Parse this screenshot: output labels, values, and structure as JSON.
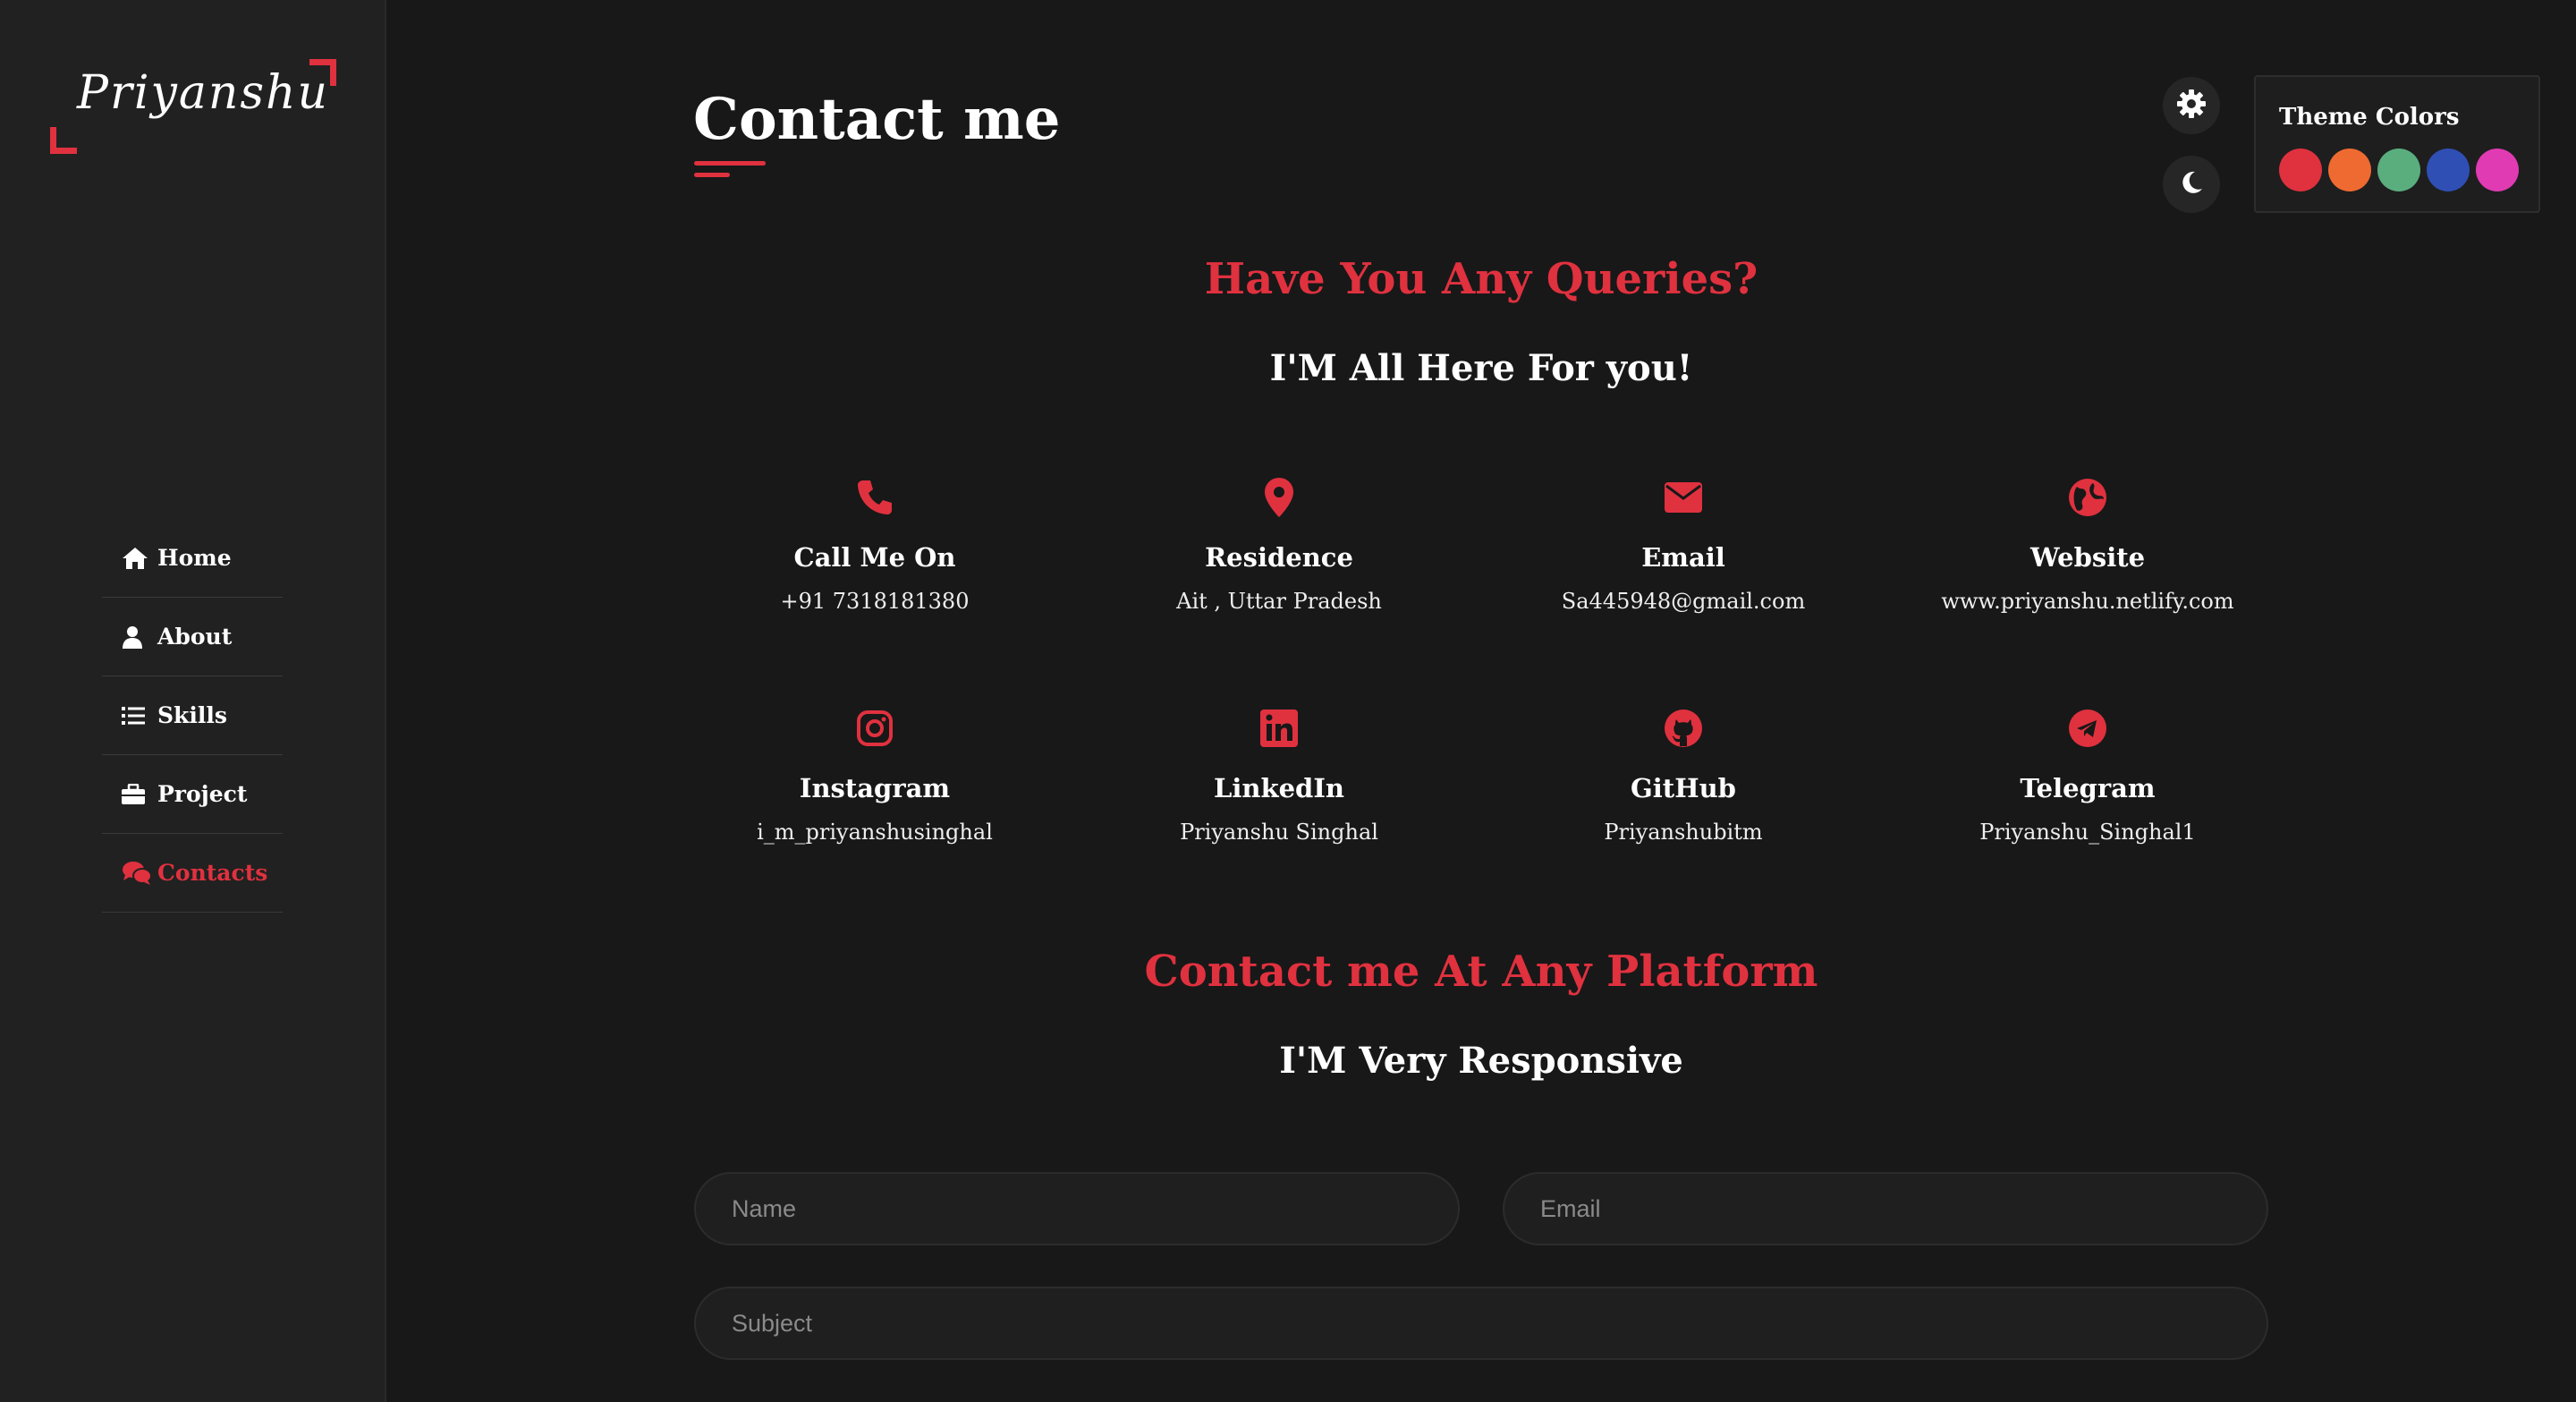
{
  "sidebar": {
    "logo_text": "Priyanshu",
    "nav": [
      {
        "label": "Home",
        "icon": "home-icon"
      },
      {
        "label": "About",
        "icon": "user-icon"
      },
      {
        "label": "Skills",
        "icon": "list-icon"
      },
      {
        "label": "Project",
        "icon": "briefcase-icon"
      },
      {
        "label": "Contacts",
        "icon": "chat-icon",
        "active": true
      }
    ]
  },
  "main": {
    "title": "Contact me",
    "queries_heading": "Have You Any Queries?",
    "queries_sub": "I'M All Here For you!",
    "contacts": [
      {
        "icon": "phone-icon",
        "title": "Call Me On",
        "value": "+91 7318181380"
      },
      {
        "icon": "location-pin-icon",
        "title": "Residence",
        "value": "Ait , Uttar Pradesh"
      },
      {
        "icon": "envelope-icon",
        "title": "Email",
        "value": "Sa445948@gmail.com"
      },
      {
        "icon": "globe-icon",
        "title": "Website",
        "value": "www.priyanshu.netlify.com"
      },
      {
        "icon": "instagram-icon",
        "title": "Instagram",
        "value": "i_m_priyanshusinghal"
      },
      {
        "icon": "linkedin-icon",
        "title": "LinkedIn",
        "value": "Priyanshu Singhal"
      },
      {
        "icon": "github-icon",
        "title": "GitHub",
        "value": "Priyanshubitm"
      },
      {
        "icon": "telegram-icon",
        "title": "Telegram",
        "value": "Priyanshu_Singhal1"
      }
    ],
    "platform_heading": "Contact me At Any Platform",
    "platform_sub": "I'M Very Responsive",
    "form": {
      "name_placeholder": "Name",
      "email_placeholder": "Email",
      "subject_placeholder": "Subject"
    }
  },
  "theme_panel": {
    "title": "Theme Colors",
    "colors": [
      "#e0313f",
      "#ef6a31",
      "#5aae7e",
      "#2f4fb5",
      "#e03bb3"
    ]
  },
  "accent_color": "#e0313f"
}
